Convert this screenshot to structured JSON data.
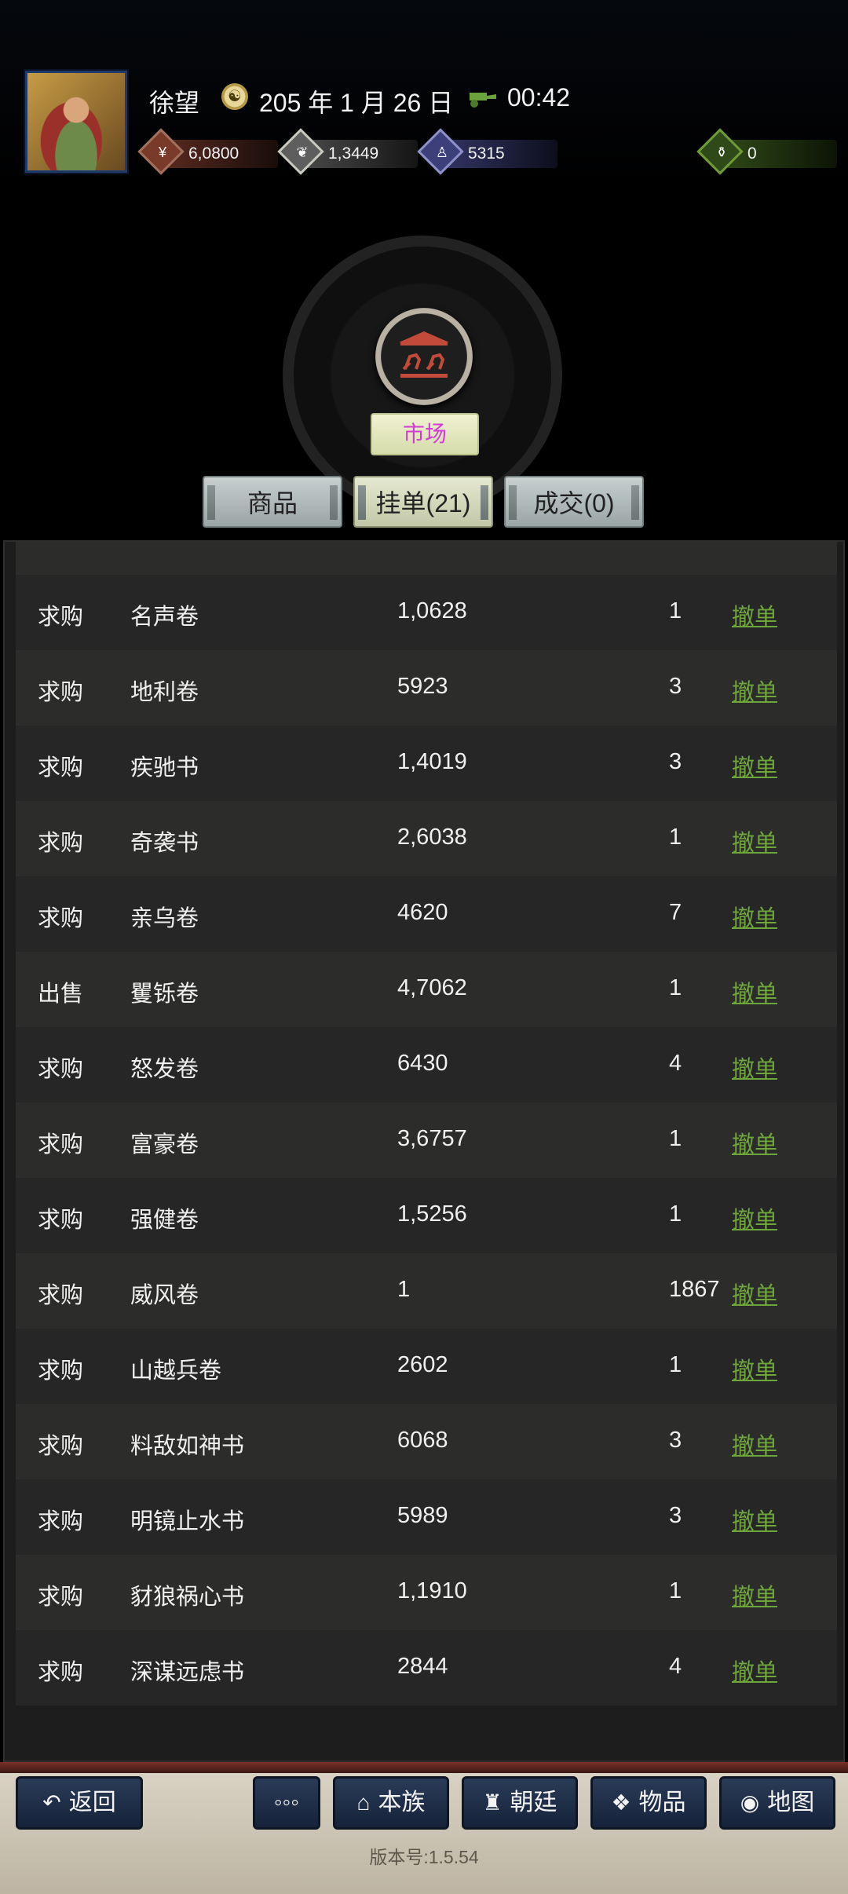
{
  "header": {
    "player_name": "徐望",
    "date": "205 年 1 月 26 日",
    "time": "00:42",
    "resources": [
      {
        "name": "coins",
        "value": "6,0800",
        "icon": "money-icon",
        "color": "#7a3a2a"
      },
      {
        "name": "grain",
        "value": "1,3449",
        "icon": "grain-icon",
        "color": "#5e5e5e"
      },
      {
        "name": "soldiers",
        "value": "5315",
        "icon": "soldier-icon",
        "color": "#3d3f7a"
      },
      {
        "name": "bag",
        "value": "0",
        "icon": "bag-icon",
        "color": "#2f4a18"
      }
    ]
  },
  "market": {
    "title": "市场"
  },
  "tabs": [
    {
      "label": "商品",
      "active": false
    },
    {
      "label": "挂单(21)",
      "active": true
    },
    {
      "label": "成交(0)",
      "active": false
    }
  ],
  "orders": [
    {
      "type": "求购",
      "item": "名声卷",
      "price": "1,0628",
      "qty": "1",
      "action": "撤单"
    },
    {
      "type": "求购",
      "item": "地利卷",
      "price": "5923",
      "qty": "3",
      "action": "撤单"
    },
    {
      "type": "求购",
      "item": "疾驰书",
      "price": "1,4019",
      "qty": "3",
      "action": "撤单"
    },
    {
      "type": "求购",
      "item": "奇袭书",
      "price": "2,6038",
      "qty": "1",
      "action": "撤单"
    },
    {
      "type": "求购",
      "item": "亲乌卷",
      "price": "4620",
      "qty": "7",
      "action": "撤单"
    },
    {
      "type": "出售",
      "item": "矍铄卷",
      "price": "4,7062",
      "qty": "1",
      "action": "撤单"
    },
    {
      "type": "求购",
      "item": "怒发卷",
      "price": "6430",
      "qty": "4",
      "action": "撤单"
    },
    {
      "type": "求购",
      "item": "富豪卷",
      "price": "3,6757",
      "qty": "1",
      "action": "撤单"
    },
    {
      "type": "求购",
      "item": "强健卷",
      "price": "1,5256",
      "qty": "1",
      "action": "撤单"
    },
    {
      "type": "求购",
      "item": "威风卷",
      "price": "1",
      "qty": "1867",
      "action": "撤单"
    },
    {
      "type": "求购",
      "item": "山越兵卷",
      "price": "2602",
      "qty": "1",
      "action": "撤单"
    },
    {
      "type": "求购",
      "item": "料敌如神书",
      "price": "6068",
      "qty": "3",
      "action": "撤单"
    },
    {
      "type": "求购",
      "item": "明镜止水书",
      "price": "5989",
      "qty": "3",
      "action": "撤单"
    },
    {
      "type": "求购",
      "item": "豺狼祸心书",
      "price": "1,1910",
      "qty": "1",
      "action": "撤单"
    },
    {
      "type": "求购",
      "item": "深谋远虑书",
      "price": "2844",
      "qty": "4",
      "action": "撤单"
    }
  ],
  "bottom_nav": {
    "back": "返回",
    "more": "◦◦◦",
    "clan": "本族",
    "court": "朝廷",
    "items": "物品",
    "map": "地图"
  },
  "version": "版本号:1.5.54",
  "colors": {
    "action_link": "#6fa63b",
    "market_label": "#d23bd6",
    "nav_button": "#1f2d47"
  }
}
